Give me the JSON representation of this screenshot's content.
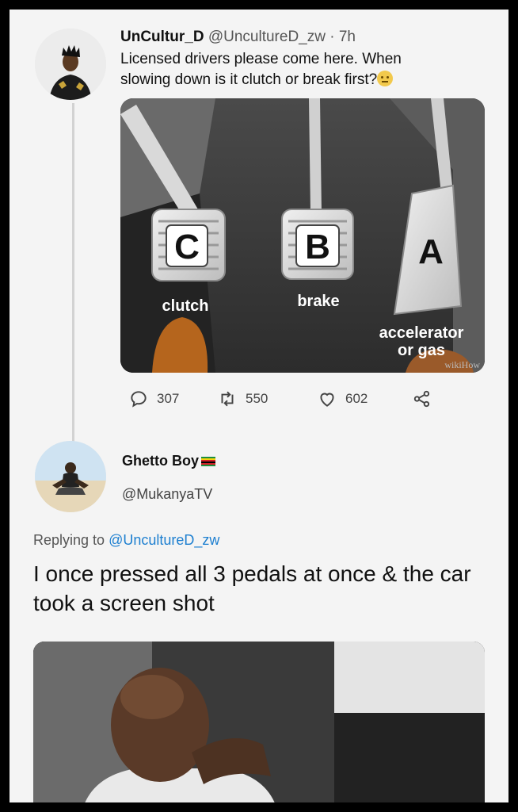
{
  "tweet": {
    "display_name": "UnCultur_D",
    "handle": "@UncultureD_zw",
    "separator": "·",
    "time": "7h",
    "text": "Licensed drivers please come here. When slowing down is it clutch or break first?",
    "media": {
      "pedals": [
        {
          "letter": "C",
          "label": "clutch"
        },
        {
          "letter": "B",
          "label": "brake"
        },
        {
          "letter": "A",
          "label": "accelerator",
          "label2": "or gas"
        }
      ],
      "watermark": "wikiHow"
    },
    "stats": {
      "replies": "307",
      "retweets": "550",
      "likes": "602"
    }
  },
  "reply": {
    "display_name": "Ghetto Boy",
    "handle": "@MukanyaTV",
    "replying_prefix": "Replying to",
    "replying_to": "@UncultureD_zw",
    "text": "I once pressed all 3 pedals at once & the car took a screen shot"
  },
  "colors": {
    "link": "#1d7fd0",
    "background": "#f4f4f4",
    "border": "#000000"
  }
}
